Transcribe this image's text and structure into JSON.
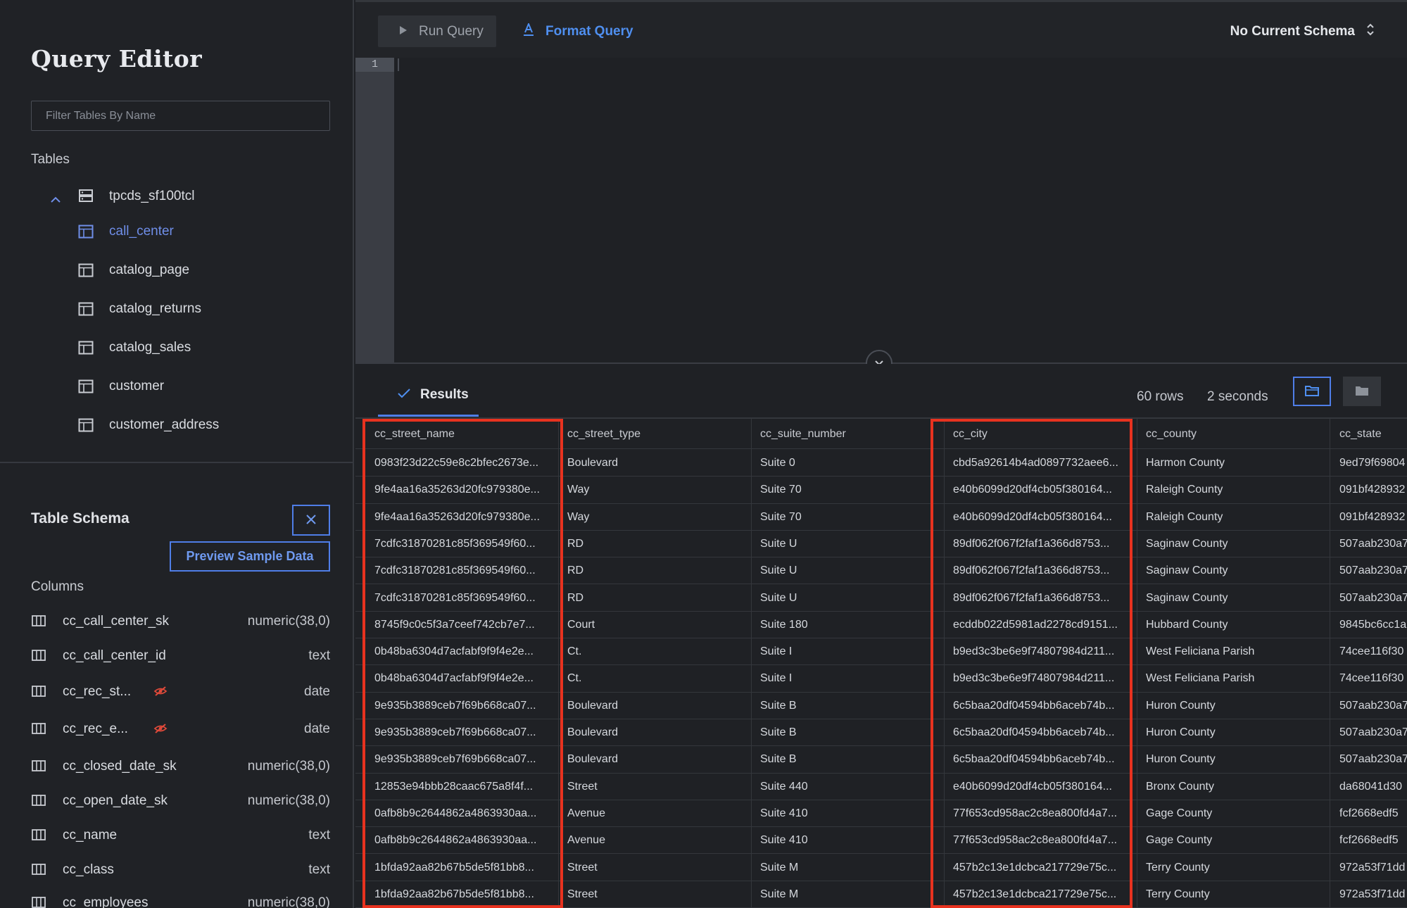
{
  "sidebar": {
    "title": "Query Editor",
    "filter_placeholder": "Filter Tables By Name",
    "tables_label": "Tables",
    "database": "tpcds_sf100tcl",
    "tables": [
      "call_center",
      "catalog_page",
      "catalog_returns",
      "catalog_sales",
      "customer",
      "customer_address"
    ],
    "active_table": "call_center",
    "schema_title": "Table Schema",
    "preview_label": "Preview Sample Data",
    "columns_label": "Columns",
    "columns": [
      {
        "name": "cc_call_center_sk",
        "type": "numeric(38,0)"
      },
      {
        "name": "cc_call_center_id",
        "type": "text"
      },
      {
        "name": "cc_rec_st...",
        "type": "date"
      },
      {
        "name": "cc_rec_e...",
        "type": "date"
      },
      {
        "name": "cc_closed_date_sk",
        "type": "numeric(38,0)"
      },
      {
        "name": "cc_open_date_sk",
        "type": "numeric(38,0)"
      },
      {
        "name": "cc_name",
        "type": "text"
      },
      {
        "name": "cc_class",
        "type": "text"
      },
      {
        "name": "cc_employees",
        "type": "numeric(38,0)"
      }
    ]
  },
  "toolbar": {
    "run_label": "Run Query",
    "format_label": "Format Query",
    "schema_label": "No Current Schema"
  },
  "editor": {
    "line_number": "1"
  },
  "results": {
    "tab_label": "Results",
    "rows_label": "60 rows",
    "duration_label": "2 seconds",
    "columns": [
      "cc_street_name",
      "cc_street_type",
      "cc_suite_number",
      "cc_city",
      "cc_county",
      "cc_state"
    ],
    "rows": [
      [
        "0983f23d22c59e8c2bfec2673e...",
        "Boulevard",
        "Suite 0",
        "cbd5a92614b4ad0897732aee6...",
        "Harmon County",
        "9ed79f69804"
      ],
      [
        "9fe4aa16a35263d20fc979380e...",
        "Way",
        "Suite 70",
        "e40b6099d20df4cb05f380164...",
        "Raleigh County",
        "091bf428932"
      ],
      [
        "9fe4aa16a35263d20fc979380e...",
        "Way",
        "Suite 70",
        "e40b6099d20df4cb05f380164...",
        "Raleigh County",
        "091bf428932"
      ],
      [
        "7cdfc31870281c85f369549f60...",
        "RD",
        "Suite U",
        "89df062f067f2faf1a366d8753...",
        "Saginaw County",
        "507aab230a7"
      ],
      [
        "7cdfc31870281c85f369549f60...",
        "RD",
        "Suite U",
        "89df062f067f2faf1a366d8753...",
        "Saginaw County",
        "507aab230a7"
      ],
      [
        "7cdfc31870281c85f369549f60...",
        "RD",
        "Suite U",
        "89df062f067f2faf1a366d8753...",
        "Saginaw County",
        "507aab230a7"
      ],
      [
        "8745f9c0c5f3a7ceef742cb7e7...",
        "Court",
        "Suite 180",
        "ecddb022d5981ad2278cd9151...",
        "Hubbard County",
        "9845bc6cc1a"
      ],
      [
        "0b48ba6304d7acfabf9f9f4e2e...",
        "Ct.",
        "Suite I",
        "b9ed3c3be6e9f74807984d211...",
        "West Feliciana Parish",
        "74cee116f30"
      ],
      [
        "0b48ba6304d7acfabf9f9f4e2e...",
        "Ct.",
        "Suite I",
        "b9ed3c3be6e9f74807984d211...",
        "West Feliciana Parish",
        "74cee116f30"
      ],
      [
        "9e935b3889ceb7f69b668ca07...",
        "Boulevard",
        "Suite B",
        "6c5baa20df04594bb6aceb74b...",
        "Huron County",
        "507aab230a7"
      ],
      [
        "9e935b3889ceb7f69b668ca07...",
        "Boulevard",
        "Suite B",
        "6c5baa20df04594bb6aceb74b...",
        "Huron County",
        "507aab230a7"
      ],
      [
        "9e935b3889ceb7f69b668ca07...",
        "Boulevard",
        "Suite B",
        "6c5baa20df04594bb6aceb74b...",
        "Huron County",
        "507aab230a7"
      ],
      [
        "12853e94bbb28caac675a8f4f...",
        "Street",
        "Suite 440",
        "e40b6099d20df4cb05f380164...",
        "Bronx County",
        "da68041d30"
      ],
      [
        "0afb8b9c2644862a4863930aa...",
        "Avenue",
        "Suite 410",
        "77f653cd958ac2c8ea800fd4a7...",
        "Gage County",
        "fcf2668edf5"
      ],
      [
        "0afb8b9c2644862a4863930aa...",
        "Avenue",
        "Suite 410",
        "77f653cd958ac2c8ea800fd4a7...",
        "Gage County",
        "fcf2668edf5"
      ],
      [
        "1bfda92aa82b67b5de5f81bb8...",
        "Street",
        "Suite M",
        "457b2c13e1dcbca217729e75c...",
        "Terry County",
        "972a53f71dd"
      ],
      [
        "1bfda92aa82b67b5de5f81bb8...",
        "Street",
        "Suite M",
        "457b2c13e1dcbca217729e75c...",
        "Terry County",
        "972a53f71dd"
      ]
    ],
    "highlighted_columns": [
      "cc_street_name",
      "cc_city"
    ]
  },
  "colors": {
    "accent": "#4f7ee8",
    "active_table": "#6f8ee8",
    "highlight": "#e8321f",
    "hidden_icon": "#e04a3a",
    "background": "#1f2125"
  },
  "icons": {
    "run": "play-icon",
    "format": "format-icon",
    "schema": "updown-chevron-icon",
    "database": "database-icon",
    "table": "table-icon",
    "column": "column-icon",
    "hidden": "eye-slash-icon",
    "close": "close-icon",
    "collapse": "chevron-down-icon",
    "export": "folder-outline-icon",
    "folder": "folder-icon",
    "results": "check-icon"
  }
}
